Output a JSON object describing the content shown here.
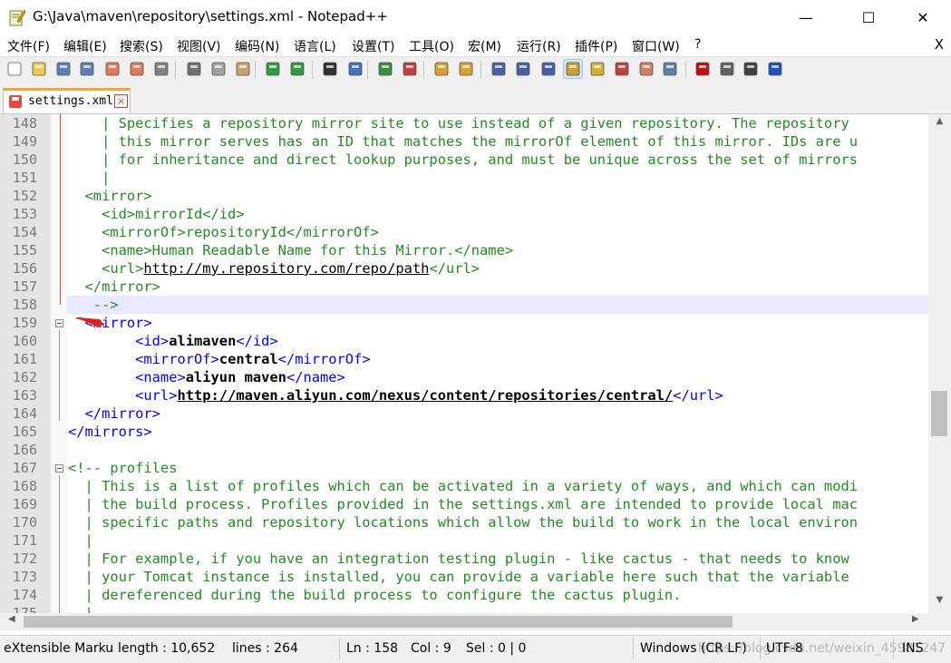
{
  "window": {
    "title": "G:\\Java\\maven\\repository\\settings.xml - Notepad++",
    "minimize_glyph": "—",
    "maximize_glyph": "☐",
    "close_glyph": "✕"
  },
  "menu": {
    "items": [
      "文件(F)",
      "编辑(E)",
      "搜索(S)",
      "视图(V)",
      "编码(N)",
      "语言(L)",
      "设置(T)",
      "工具(O)",
      "宏(M)",
      "运行(R)",
      "插件(P)",
      "窗口(W)",
      "?"
    ],
    "close_doc": "X"
  },
  "toolbar": {
    "icons": [
      "new-file-icon",
      "open-file-icon",
      "save-icon",
      "save-all-icon",
      "close-icon",
      "close-all-icon",
      "print-icon",
      "cut-icon",
      "copy-icon",
      "paste-icon",
      "undo-icon",
      "redo-icon",
      "find-icon",
      "replace-icon",
      "zoom-in-icon",
      "zoom-out-icon",
      "sync-vertical-icon",
      "sync-horizontal-icon",
      "word-wrap-icon",
      "show-all-chars-icon",
      "indent-guide-icon",
      "doc-map-icon",
      "function-list-icon",
      "folder-workspace-icon",
      "monitor-icon",
      "record-macro-icon",
      "stop-record-icon",
      "play-macro-icon",
      "run-macro-multiple-icon",
      "save-macro-icon"
    ]
  },
  "tab": {
    "label": "settings.xml",
    "close_glyph": "×"
  },
  "editor": {
    "lines": [
      {
        "n": "148",
        "parts": [
          [
            "c",
            "    | Specifies a repository mirror site to use instead of a given repository. The repository"
          ]
        ]
      },
      {
        "n": "149",
        "parts": [
          [
            "c",
            "    | this mirror serves has an ID that matches the mirrorOf element of this mirror. IDs are u"
          ]
        ]
      },
      {
        "n": "150",
        "parts": [
          [
            "c",
            "    | for inheritance and direct lookup purposes, and must be unique across the set of mirrors"
          ]
        ]
      },
      {
        "n": "151",
        "parts": [
          [
            "c",
            "    |"
          ]
        ]
      },
      {
        "n": "152",
        "parts": [
          [
            "c",
            "  <mirror>"
          ]
        ]
      },
      {
        "n": "153",
        "parts": [
          [
            "c",
            "    <id>mirrorId</id>"
          ]
        ]
      },
      {
        "n": "154",
        "parts": [
          [
            "c",
            "    <mirrorOf>repositoryId</mirrorOf>"
          ]
        ]
      },
      {
        "n": "155",
        "parts": [
          [
            "c",
            "    <name>Human Readable Name for this Mirror.</name>"
          ]
        ]
      },
      {
        "n": "156",
        "parts": [
          [
            "c",
            "    <url>"
          ],
          [
            "cl",
            "http://my.repository.com/repo/path"
          ],
          [
            "c",
            "</url>"
          ]
        ]
      },
      {
        "n": "157",
        "parts": [
          [
            "c",
            "  </mirror>"
          ]
        ]
      },
      {
        "n": "158",
        "parts": [
          [
            "c",
            "   -->"
          ]
        ],
        "hl": true
      },
      {
        "n": "159",
        "parts": [
          [
            "tag",
            "  <mirror>"
          ]
        ]
      },
      {
        "n": "160",
        "parts": [
          [
            "tag",
            "        <id>"
          ],
          [
            "bold",
            "alimaven"
          ],
          [
            "tag",
            "</id>"
          ]
        ]
      },
      {
        "n": "161",
        "parts": [
          [
            "tag",
            "        <mirrorOf>"
          ],
          [
            "bold",
            "central"
          ],
          [
            "tag",
            "</mirrorOf>"
          ]
        ]
      },
      {
        "n": "162",
        "parts": [
          [
            "tag",
            "        <name>"
          ],
          [
            "bold",
            "aliyun maven"
          ],
          [
            "tag",
            "</name>"
          ]
        ]
      },
      {
        "n": "163",
        "parts": [
          [
            "tag",
            "        <url>"
          ],
          [
            "bu",
            "http://maven.aliyun.com/nexus/content/repositories/central/"
          ],
          [
            "tag",
            "</url>"
          ]
        ]
      },
      {
        "n": "164",
        "parts": [
          [
            "tag",
            "  </mirror>"
          ]
        ]
      },
      {
        "n": "165",
        "parts": [
          [
            "tag",
            "</mirrors>"
          ]
        ]
      },
      {
        "n": "166",
        "parts": [
          [
            "txt",
            ""
          ]
        ]
      },
      {
        "n": "167",
        "parts": [
          [
            "c",
            "<!-- profiles"
          ]
        ]
      },
      {
        "n": "168",
        "parts": [
          [
            "c",
            "  | This is a list of profiles which can be activated in a variety of ways, and which can modi"
          ]
        ]
      },
      {
        "n": "169",
        "parts": [
          [
            "c",
            "  | the build process. Profiles provided in the settings.xml are intended to provide local mac"
          ]
        ]
      },
      {
        "n": "170",
        "parts": [
          [
            "c",
            "  | specific paths and repository locations which allow the build to work in the local environ"
          ]
        ]
      },
      {
        "n": "171",
        "parts": [
          [
            "c",
            "  |"
          ]
        ]
      },
      {
        "n": "172",
        "parts": [
          [
            "c",
            "  | For example, if you have an integration testing plugin - like cactus - that needs to know"
          ]
        ]
      },
      {
        "n": "173",
        "parts": [
          [
            "c",
            "  | your Tomcat instance is installed, you can provide a variable here such that the variable"
          ]
        ]
      },
      {
        "n": "174",
        "parts": [
          [
            "c",
            "  | dereferenced during the build process to configure the cactus plugin."
          ]
        ]
      },
      {
        "n": "175",
        "parts": [
          [
            "c",
            "  |"
          ]
        ]
      }
    ]
  },
  "status": {
    "lang": "eXtensible Marku",
    "length": "length : 10,652",
    "lines": "lines : 264",
    "ln": "Ln : 158",
    "col": "Col : 9",
    "sel": "Sel : 0 | 0",
    "eol": "Windows (CR LF)",
    "encoding": "UTF-8",
    "mode": "INS",
    "watermark": "https://blog.csdn.net/weixin_45981247"
  },
  "colors": {
    "comment": "#228b22",
    "tag": "#0000ff",
    "current_line": "#e8e8ff",
    "change_bar": "#e04040"
  }
}
